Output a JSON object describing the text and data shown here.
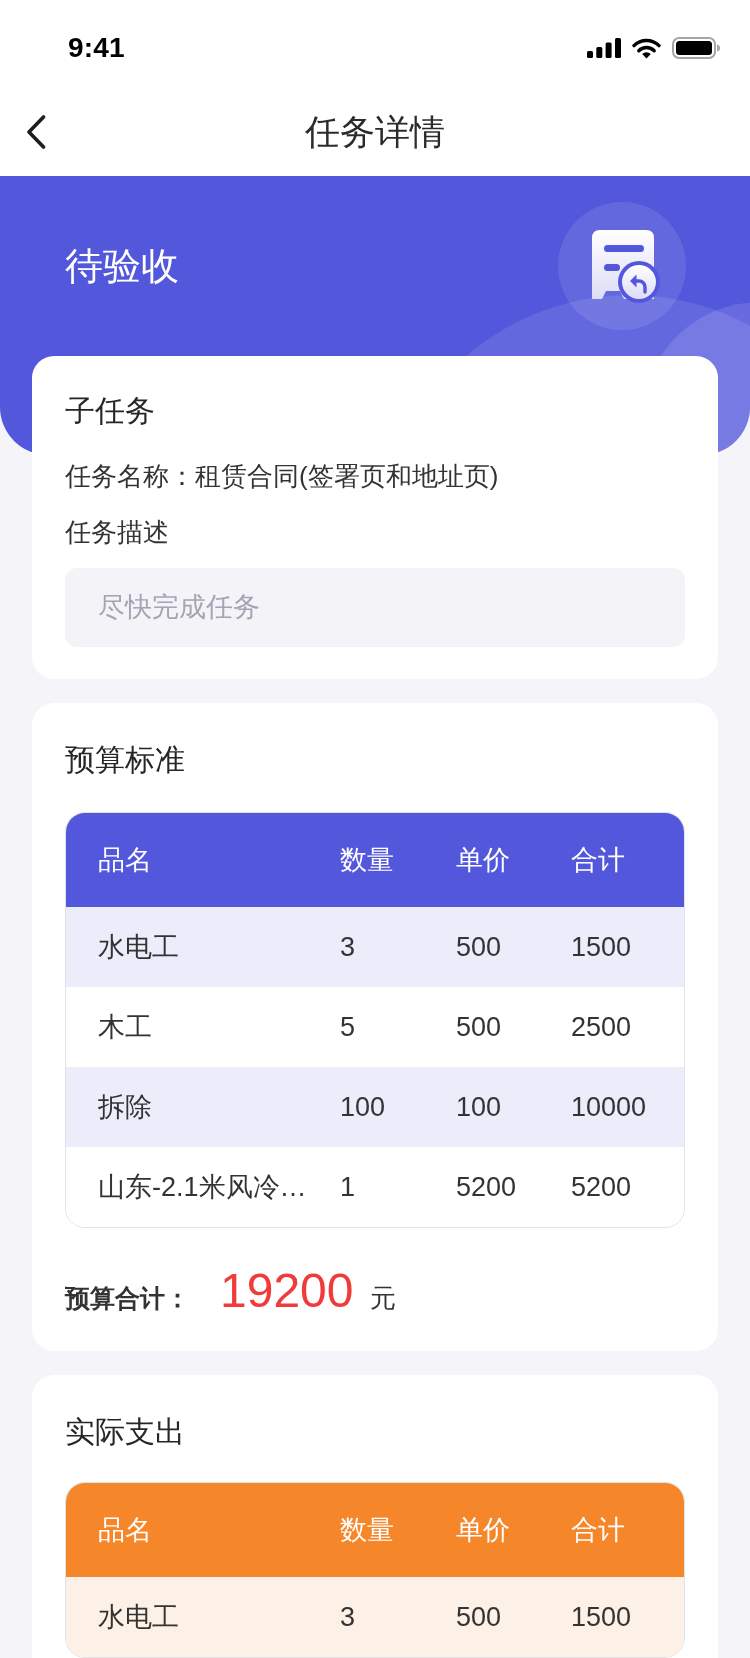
{
  "status_bar": {
    "time": "9:41"
  },
  "nav": {
    "title": "任务详情"
  },
  "header": {
    "status": "待验收"
  },
  "subtask": {
    "title": "子任务",
    "name_label": "任务名称：",
    "name": "租赁合同(签署页和地址页)",
    "description_label": "任务描述",
    "description": {
      "placeholder": "尽快完成任务"
    }
  },
  "budget": {
    "title": "预算标准",
    "table": {
      "columns": [
        "品名",
        "数量",
        "单价",
        "合计"
      ],
      "rows": [
        [
          "水电工",
          "3",
          "500",
          "1500"
        ],
        [
          "木工",
          "5",
          "500",
          "2500"
        ],
        [
          "拆除",
          "100",
          "100",
          "10000"
        ],
        [
          "山东-2.1米风冷…",
          "1",
          "5200",
          "5200"
        ]
      ]
    },
    "total_label": "预算合计：",
    "total": "19200",
    "unit": "元"
  },
  "actual": {
    "title": "实际支出",
    "table": {
      "columns": [
        "品名",
        "数量",
        "单价",
        "合计"
      ],
      "rows": [
        [
          "水电工",
          "3",
          "500",
          "1500"
        ]
      ]
    }
  }
}
